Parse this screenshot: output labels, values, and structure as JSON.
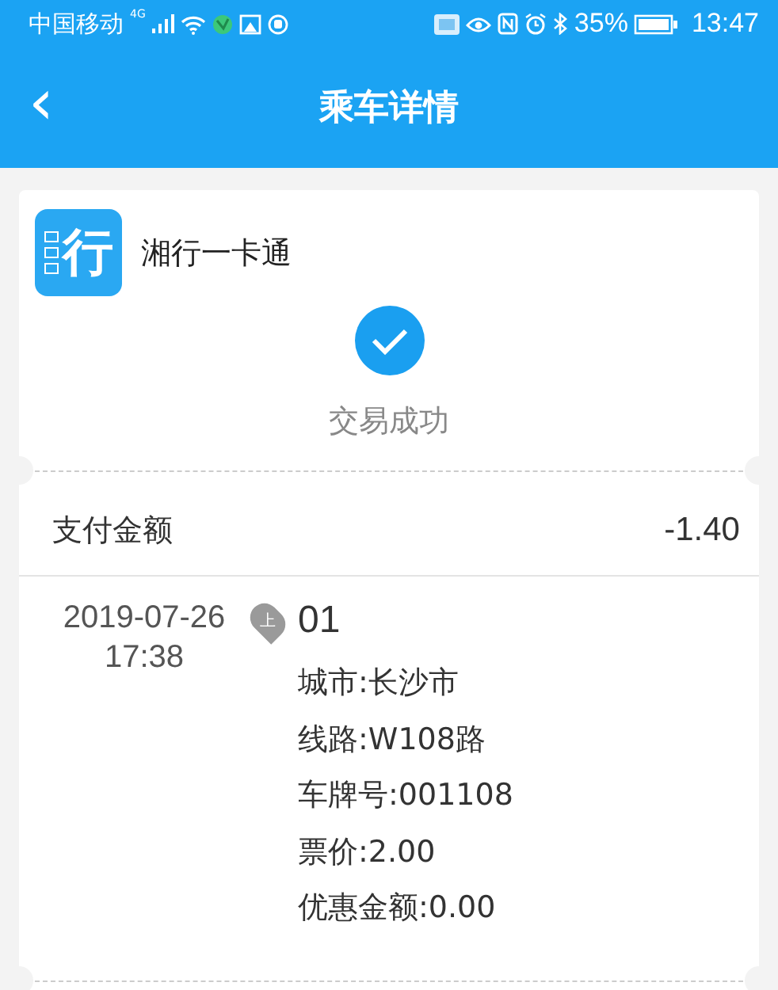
{
  "status_bar": {
    "carrier": "中国移动",
    "network": "4G",
    "battery": "35%",
    "time": "13:47"
  },
  "header": {
    "back": "‹",
    "title": "乘车详情"
  },
  "card": {
    "logo": "行",
    "name": "湘行一卡通",
    "result": {
      "success": true,
      "label": "交易成功"
    },
    "payment": {
      "label": "支付金额",
      "amount": "-1.40"
    },
    "trip": {
      "date": "2019-07-26",
      "time": "17:38",
      "pin": "上",
      "station": "01",
      "details": [
        "城市:长沙市",
        "线路:W108路",
        "车牌号:001108",
        "票价:2.00",
        "优惠金额:0.00"
      ]
    }
  }
}
